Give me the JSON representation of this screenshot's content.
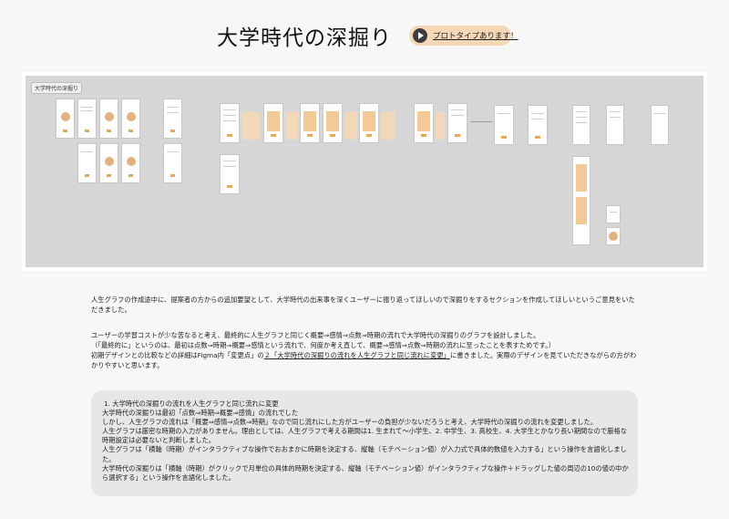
{
  "header": {
    "title": "大学時代の深掘り",
    "prototype_label": "プロトタイプあります！"
  },
  "canvas": {
    "frame_label": "大学時代の深掘り"
  },
  "intro": {
    "line1": "人生グラフの作成途中に、提案者の方からの追加要望として、大学時代の出来事を深くユーザーに振り返ってほしいので深掘りをするセクションを作成してほしいというご意見をいただきました。"
  },
  "summary": {
    "line1": "ユーザーの学習コストが少な苦なると考え、最終的に人生グラフと同じく概要⇒感情⇒点数⇒時期の流れで大学時代の深掘りのグラフを設計しました。",
    "line2": "（「最終的に」というのは、最初は点数⇒時期⇒概要⇒感情という流れで、何度か考え直して、概要⇒感情⇒点数⇒時期の流れに至ったことを表すためです。）",
    "line3_pre": "初期デザインとの比較などの詳細はFigma内「変更点」の",
    "line3_link": "２「大学時代の深掘りの流れを人生グラフと同じ流れに変更」",
    "line3_post": "に書きました。実際のデザインを見ていただきながらの方がわかりやすいと思います。"
  },
  "change": {
    "heading": "1. 大学時代の深掘りの流れを人生グラフと同じ流れに変更",
    "l1": "大学時代の深掘りは最初「点数⇒時期⇒概要⇒感情」の流れでした",
    "l2": "しかし、人生グラフの流れは「概要⇒感情⇒点数⇒時期」なので同じ流れにした方がユーザーの負担が少ないだろうと考え、大学時代の深掘りの流れを変更しました。",
    "l3": "人生グラフは厳密な時期の入力がありません。理由としては、人生グラフで考える期間は1. 生まれて〜小学生、2. 中学生、3. 高校生、4. 大学生とかなり長い期間なので厳格な時期設定は必要ないと判断しました。",
    "l4": "人生グラフは「横軸（時期）がインタラクティブな操作でおおまかに時期を決定する、縦軸（モチベーション値）が入力式で具体的数値を入力する」という操作を言語化しました。",
    "l5": "大学時代の深掘りは「横軸（時期）がクリックで月単位の具体的時期を決定する、縦軸（モチベーション値）がインタラクティブな操作＋ドラッグした値の周辺の10の値の中から選択する」という操作を言語化しました。"
  },
  "colors": {
    "accent": "#f1a64a",
    "button_bg": "#f4d7b4",
    "canvas_bg": "#d6d6d6",
    "note_bg": "#e7e7e7"
  }
}
